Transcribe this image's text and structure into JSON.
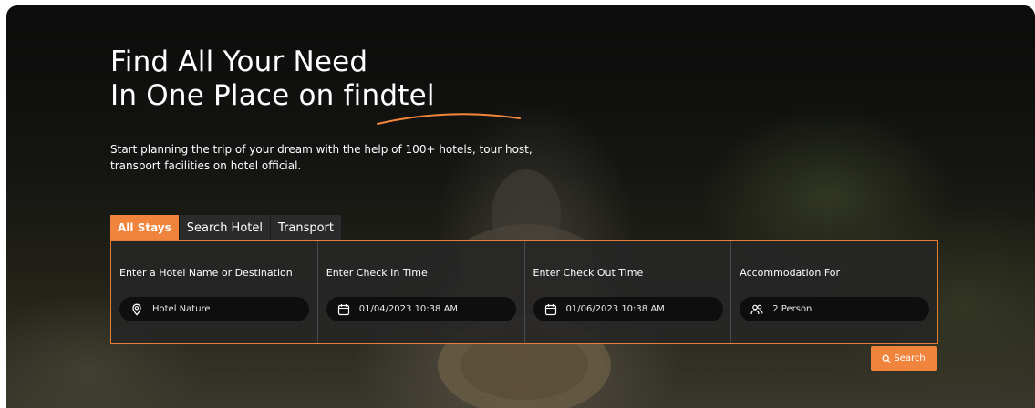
{
  "hero": {
    "headline_line1": "Find All Your Need",
    "headline_line2": "In One Place on findtel",
    "subtitle": "Start planning the trip of your dream with the help of 100+ hotels, tour host, transport facilities on hotel official."
  },
  "tabs": [
    {
      "label": "All Stays",
      "active": true
    },
    {
      "label": "Search Hotel",
      "active": false
    },
    {
      "label": "Transport",
      "active": false
    }
  ],
  "fields": [
    {
      "label": "Enter a Hotel Name or Destination",
      "value": "Hotel Nature",
      "icon": "location-pin-icon"
    },
    {
      "label": "Enter Check In Time",
      "value": "01/04/2023 10:38  AM",
      "icon": "calendar-icon"
    },
    {
      "label": "Enter Check Out Time",
      "value": "01/06/2023 10:38  AM",
      "icon": "calendar-icon"
    },
    {
      "label": "Accommodation For",
      "value": "2 Person",
      "icon": "people-icon"
    }
  ],
  "search_button": {
    "label": "Search",
    "icon": "search-icon"
  },
  "colors": {
    "accent": "#f0843c",
    "panel_border": "#e37f39",
    "input_bg": "#0e0e0e"
  }
}
